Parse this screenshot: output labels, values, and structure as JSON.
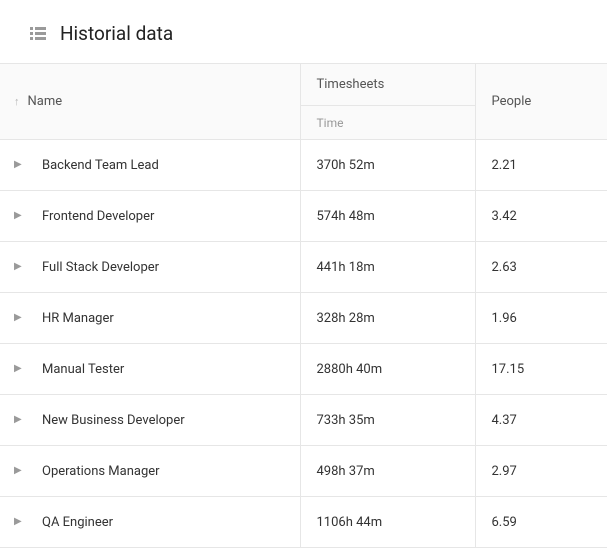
{
  "header": {
    "title": "Historial data"
  },
  "columns": {
    "name": "Name",
    "timesheets": "Timesheets",
    "timesheets_sub": "Time",
    "people": "People"
  },
  "rows": [
    {
      "name": "Backend Team Lead",
      "time": "370h 52m",
      "people": "2.21"
    },
    {
      "name": "Frontend Developer",
      "time": "574h 48m",
      "people": "3.42"
    },
    {
      "name": "Full Stack Developer",
      "time": "441h 18m",
      "people": "2.63"
    },
    {
      "name": "HR Manager",
      "time": "328h 28m",
      "people": "1.96"
    },
    {
      "name": "Manual Tester",
      "time": "2880h 40m",
      "people": "17.15"
    },
    {
      "name": "New Business Developer",
      "time": "733h 35m",
      "people": "4.37"
    },
    {
      "name": "Operations Manager",
      "time": "498h 37m",
      "people": "2.97"
    },
    {
      "name": "QA Engineer",
      "time": "1106h 44m",
      "people": "6.59"
    }
  ]
}
